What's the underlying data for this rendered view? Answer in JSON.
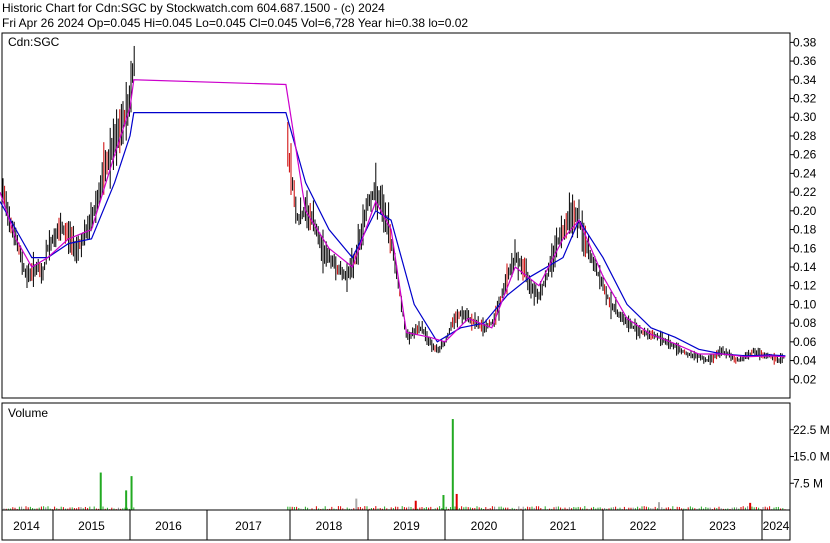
{
  "header": {
    "line1": "Historic Chart for Cdn:SGC by Stockwatch.com 604.687.1500 - (c) 2024",
    "line2": "Fri Apr 26 2024   Op=0.045   Hi=0.045   Lo=0.045   Cl=0.045   Vol=6,728   Year hi=0.38   lo=0.02"
  },
  "chart_data": [
    {
      "type": "line",
      "title": "Cdn:SGC",
      "y_ticks": [
        "0.38",
        "0.36",
        "0.34",
        "0.32",
        "0.30",
        "0.28",
        "0.26",
        "0.24",
        "0.22",
        "0.20",
        "0.18",
        "0.16",
        "0.14",
        "0.12",
        "0.10",
        "0.08",
        "0.06",
        "0.04",
        "0.02"
      ],
      "ylim": [
        0,
        0.39
      ],
      "grid": false,
      "price_series": [
        [
          2014.0,
          0.23
        ],
        [
          2014.1,
          0.21
        ],
        [
          2014.2,
          0.19
        ],
        [
          2014.3,
          0.17
        ],
        [
          2014.4,
          0.15
        ],
        [
          2014.5,
          0.13
        ],
        [
          2014.6,
          0.135
        ],
        [
          2014.7,
          0.14
        ],
        [
          2014.8,
          0.13
        ],
        [
          2014.9,
          0.16
        ],
        [
          2015.0,
          0.17
        ],
        [
          2015.1,
          0.18
        ],
        [
          2015.2,
          0.175
        ],
        [
          2015.3,
          0.16
        ],
        [
          2015.4,
          0.17
        ],
        [
          2015.5,
          0.19
        ],
        [
          2015.6,
          0.22
        ],
        [
          2015.7,
          0.25
        ],
        [
          2015.8,
          0.27
        ],
        [
          2015.9,
          0.29
        ],
        [
          2016.0,
          0.32
        ],
        [
          2016.05,
          0.36
        ],
        [
          2017.0,
          0.335
        ],
        [
          2017.9,
          0.34
        ],
        [
          2018.0,
          0.25
        ],
        [
          2018.1,
          0.19
        ],
        [
          2018.2,
          0.2
        ],
        [
          2018.3,
          0.19
        ],
        [
          2018.4,
          0.16
        ],
        [
          2018.5,
          0.15
        ],
        [
          2018.6,
          0.14
        ],
        [
          2018.7,
          0.13
        ],
        [
          2018.8,
          0.14
        ],
        [
          2018.9,
          0.17
        ],
        [
          2019.0,
          0.21
        ],
        [
          2019.1,
          0.22
        ],
        [
          2019.2,
          0.2
        ],
        [
          2019.3,
          0.17
        ],
        [
          2019.4,
          0.12
        ],
        [
          2019.5,
          0.065
        ],
        [
          2019.6,
          0.07
        ],
        [
          2019.7,
          0.075
        ],
        [
          2019.8,
          0.06
        ],
        [
          2019.9,
          0.05
        ],
        [
          2020.0,
          0.06
        ],
        [
          2020.1,
          0.08
        ],
        [
          2020.2,
          0.09
        ],
        [
          2020.3,
          0.085
        ],
        [
          2020.4,
          0.08
        ],
        [
          2020.5,
          0.075
        ],
        [
          2020.6,
          0.08
        ],
        [
          2020.7,
          0.1
        ],
        [
          2020.8,
          0.13
        ],
        [
          2020.9,
          0.15
        ],
        [
          2021.0,
          0.14
        ],
        [
          2021.1,
          0.12
        ],
        [
          2021.2,
          0.11
        ],
        [
          2021.3,
          0.13
        ],
        [
          2021.4,
          0.16
        ],
        [
          2021.5,
          0.18
        ],
        [
          2021.6,
          0.2
        ],
        [
          2021.7,
          0.19
        ],
        [
          2021.8,
          0.16
        ],
        [
          2021.9,
          0.14
        ],
        [
          2022.0,
          0.12
        ],
        [
          2022.1,
          0.1
        ],
        [
          2022.2,
          0.09
        ],
        [
          2022.3,
          0.08
        ],
        [
          2022.4,
          0.075
        ],
        [
          2022.5,
          0.07
        ],
        [
          2022.6,
          0.068
        ],
        [
          2022.7,
          0.065
        ],
        [
          2022.8,
          0.06
        ],
        [
          2022.9,
          0.055
        ],
        [
          2023.0,
          0.05
        ],
        [
          2023.1,
          0.045
        ],
        [
          2023.2,
          0.045
        ],
        [
          2023.3,
          0.04
        ],
        [
          2023.4,
          0.045
        ],
        [
          2023.5,
          0.05
        ],
        [
          2023.6,
          0.045
        ],
        [
          2023.7,
          0.04
        ],
        [
          2023.8,
          0.045
        ],
        [
          2023.9,
          0.05
        ],
        [
          2024.0,
          0.045
        ],
        [
          2024.1,
          0.045
        ],
        [
          2024.2,
          0.04
        ],
        [
          2024.3,
          0.045
        ]
      ],
      "ma_fast": [
        [
          2014.0,
          0.22
        ],
        [
          2014.3,
          0.17
        ],
        [
          2014.6,
          0.14
        ],
        [
          2014.9,
          0.15
        ],
        [
          2015.2,
          0.17
        ],
        [
          2015.5,
          0.18
        ],
        [
          2015.8,
          0.26
        ],
        [
          2016.0,
          0.31
        ],
        [
          2016.05,
          0.34
        ],
        [
          2017.95,
          0.335
        ],
        [
          2018.2,
          0.2
        ],
        [
          2018.5,
          0.16
        ],
        [
          2018.8,
          0.14
        ],
        [
          2019.1,
          0.21
        ],
        [
          2019.3,
          0.18
        ],
        [
          2019.5,
          0.07
        ],
        [
          2019.8,
          0.065
        ],
        [
          2020.0,
          0.06
        ],
        [
          2020.3,
          0.085
        ],
        [
          2020.6,
          0.075
        ],
        [
          2020.9,
          0.14
        ],
        [
          2021.2,
          0.12
        ],
        [
          2021.5,
          0.17
        ],
        [
          2021.7,
          0.19
        ],
        [
          2022.0,
          0.13
        ],
        [
          2022.3,
          0.085
        ],
        [
          2022.6,
          0.068
        ],
        [
          2022.9,
          0.058
        ],
        [
          2023.2,
          0.047
        ],
        [
          2023.5,
          0.047
        ],
        [
          2023.8,
          0.044
        ],
        [
          2024.1,
          0.045
        ],
        [
          2024.3,
          0.044
        ]
      ],
      "ma_slow": [
        [
          2014.0,
          0.21
        ],
        [
          2014.3,
          0.18
        ],
        [
          2014.6,
          0.15
        ],
        [
          2014.9,
          0.15
        ],
        [
          2015.2,
          0.165
        ],
        [
          2015.5,
          0.17
        ],
        [
          2015.8,
          0.23
        ],
        [
          2016.0,
          0.28
        ],
        [
          2016.05,
          0.305
        ],
        [
          2017.95,
          0.305
        ],
        [
          2018.2,
          0.23
        ],
        [
          2018.5,
          0.18
        ],
        [
          2018.8,
          0.15
        ],
        [
          2019.1,
          0.2
        ],
        [
          2019.3,
          0.19
        ],
        [
          2019.6,
          0.1
        ],
        [
          2019.9,
          0.06
        ],
        [
          2020.2,
          0.075
        ],
        [
          2020.5,
          0.08
        ],
        [
          2020.8,
          0.11
        ],
        [
          2021.1,
          0.13
        ],
        [
          2021.5,
          0.15
        ],
        [
          2021.7,
          0.19
        ],
        [
          2022.0,
          0.15
        ],
        [
          2022.3,
          0.1
        ],
        [
          2022.6,
          0.075
        ],
        [
          2022.9,
          0.065
        ],
        [
          2023.2,
          0.052
        ],
        [
          2023.5,
          0.047
        ],
        [
          2023.8,
          0.045
        ],
        [
          2024.1,
          0.046
        ],
        [
          2024.3,
          0.045
        ]
      ]
    },
    {
      "type": "bar",
      "title": "Volume",
      "y_ticks": [
        "22.5 M",
        "15.0 M",
        "7.5 M"
      ],
      "ylim": [
        0,
        30
      ],
      "grid": false,
      "spikes": [
        {
          "x": 2015.62,
          "value": 10.5,
          "color": "#22aa22"
        },
        {
          "x": 2015.95,
          "value": 5.5,
          "color": "#22aa22"
        },
        {
          "x": 2016.02,
          "value": 9.5,
          "color": "#22aa22"
        },
        {
          "x": 2018.85,
          "value": 3.2,
          "color": "#aaaaaa"
        },
        {
          "x": 2019.62,
          "value": 2.6,
          "color": "#dd0000"
        },
        {
          "x": 2019.98,
          "value": 4.2,
          "color": "#22aa22"
        },
        {
          "x": 2020.1,
          "value": 25.5,
          "color": "#22aa22"
        },
        {
          "x": 2020.15,
          "value": 4.5,
          "color": "#dd0000"
        },
        {
          "x": 2022.7,
          "value": 2.2,
          "color": "#aaaaaa"
        },
        {
          "x": 2023.85,
          "value": 2.0,
          "color": "#dd0000"
        }
      ]
    },
    {
      "type": "table",
      "title": "",
      "x_ticks": [
        "2014",
        "2015",
        "2016",
        "2017",
        "2018",
        "2019",
        "2020",
        "2021",
        "2022",
        "2023",
        "2024"
      ]
    }
  ]
}
